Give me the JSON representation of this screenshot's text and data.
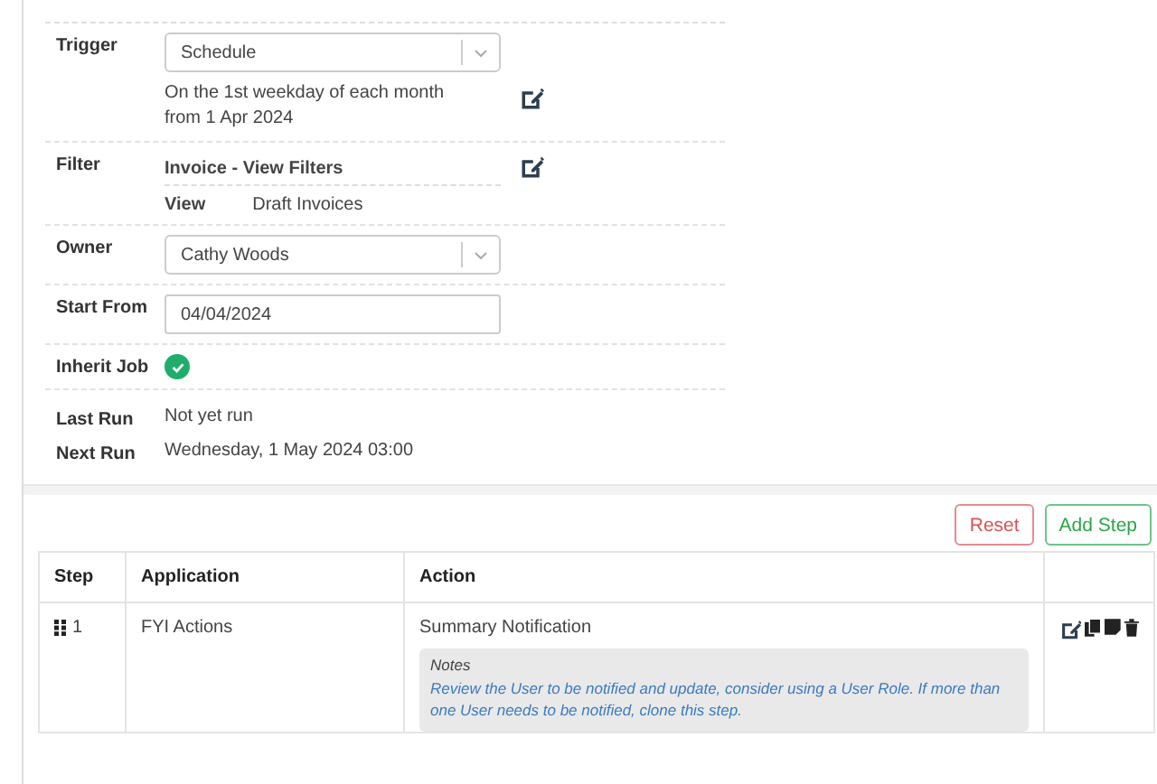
{
  "form": {
    "trigger": {
      "label": "Trigger",
      "value": "Schedule",
      "description": [
        "On the 1st weekday of each month",
        "from 1 Apr 2024"
      ]
    },
    "filter": {
      "label": "Filter",
      "title": "Invoice - View Filters",
      "view_label": "View",
      "view_value": "Draft Invoices"
    },
    "owner": {
      "label": "Owner",
      "value": "Cathy Woods"
    },
    "start_from": {
      "label": "Start From",
      "value": "04/04/2024"
    },
    "inherit_job": {
      "label": "Inherit Job",
      "checked": true
    },
    "last_run": {
      "label": "Last Run",
      "value": "Not yet run"
    },
    "next_run": {
      "label": "Next Run",
      "value": "Wednesday, 1 May 2024 03:00"
    }
  },
  "buttons": [
    {
      "label": "Reset",
      "kind": "danger"
    },
    {
      "label": "Add Step",
      "kind": "success"
    }
  ],
  "table": {
    "columns": [
      "Step",
      "Application",
      "Action"
    ],
    "rows": [
      {
        "step": "1",
        "application": "FYI Actions",
        "action": "Summary Notification",
        "notes_title": "Notes",
        "notes": "Review the User to be notified and update, consider using a User Role. If more than one User needs to be notified, clone this step."
      }
    ]
  }
}
